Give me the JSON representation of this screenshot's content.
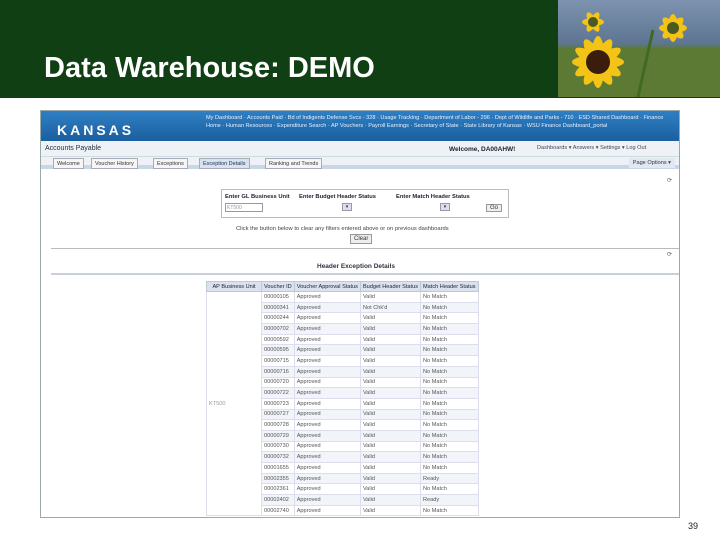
{
  "slide": {
    "title": "Data Warehouse:  DEMO",
    "page_number": "39"
  },
  "app": {
    "logo": "KANSAS",
    "links": "My Dashboard · Accounts Paid · Bd of Indigents Defense Svcs - 328 · Usage Tracking · Department of Labor - 296 · Dept of Wildlife and Parks - 710 · ESD Shared Dashboard · Finance Home · Human Resources · Expenditure Search · AP Vouchers · Payroll Earnings · Secretary of State · State Library of Kansas · WSU Finance Dashboard_portal",
    "section": "Accounts Payable",
    "welcome": "Welcome, DA00AHW!",
    "top_links": "Dashboards ▾  Answers ▾  Settings ▾  Log Out",
    "tabs": [
      "Welcome",
      "Voucher History",
      "Exceptions",
      "Exception Details",
      "Ranking and Trends"
    ],
    "active_tab": "Exception Details",
    "page_options": "Page Options ▾"
  },
  "filters": {
    "gl_label": "Enter GL Business Unit",
    "gl_value": "KT500",
    "budget_label": "Enter Budget Header Status",
    "match_label": "Enter Match Header Status",
    "go": "Go",
    "clear_text": "Click the button below to clear any filters entered above or on previous dashboards",
    "clear": "Clear"
  },
  "report": {
    "title": "Header Exception Details",
    "columns": [
      "AP Business Unit",
      "Voucher ID",
      "Voucher Approval Status",
      "Budget Header Status",
      "Match Header Status"
    ],
    "business_unit": "KT500",
    "rows": [
      [
        "00000105",
        "Approved",
        "Valid",
        "No Match"
      ],
      [
        "00000341",
        "Approved",
        "Not Chk'd",
        "No Match"
      ],
      [
        "00000244",
        "Approved",
        "Valid",
        "No Match"
      ],
      [
        "00000702",
        "Approved",
        "Valid",
        "No Match"
      ],
      [
        "00000592",
        "Approved",
        "Valid",
        "No Match"
      ],
      [
        "00000595",
        "Approved",
        "Valid",
        "No Match"
      ],
      [
        "00000715",
        "Approved",
        "Valid",
        "No Match"
      ],
      [
        "00000716",
        "Approved",
        "Valid",
        "No Match"
      ],
      [
        "00000720",
        "Approved",
        "Valid",
        "No Match"
      ],
      [
        "00000722",
        "Approved",
        "Valid",
        "No Match"
      ],
      [
        "00000723",
        "Approved",
        "Valid",
        "No Match"
      ],
      [
        "00000727",
        "Approved",
        "Valid",
        "No Match"
      ],
      [
        "00000728",
        "Approved",
        "Valid",
        "No Match"
      ],
      [
        "00000729",
        "Approved",
        "Valid",
        "No Match"
      ],
      [
        "00000730",
        "Approved",
        "Valid",
        "No Match"
      ],
      [
        "00000732",
        "Approved",
        "Valid",
        "No Match"
      ],
      [
        "00001655",
        "Approved",
        "Valid",
        "No Match"
      ],
      [
        "00002355",
        "Approved",
        "Valid",
        "Ready"
      ],
      [
        "00002361",
        "Approved",
        "Valid",
        "No Match"
      ],
      [
        "00002402",
        "Approved",
        "Valid",
        "Ready"
      ],
      [
        "00002740",
        "Approved",
        "Valid",
        "No Match"
      ]
    ]
  }
}
